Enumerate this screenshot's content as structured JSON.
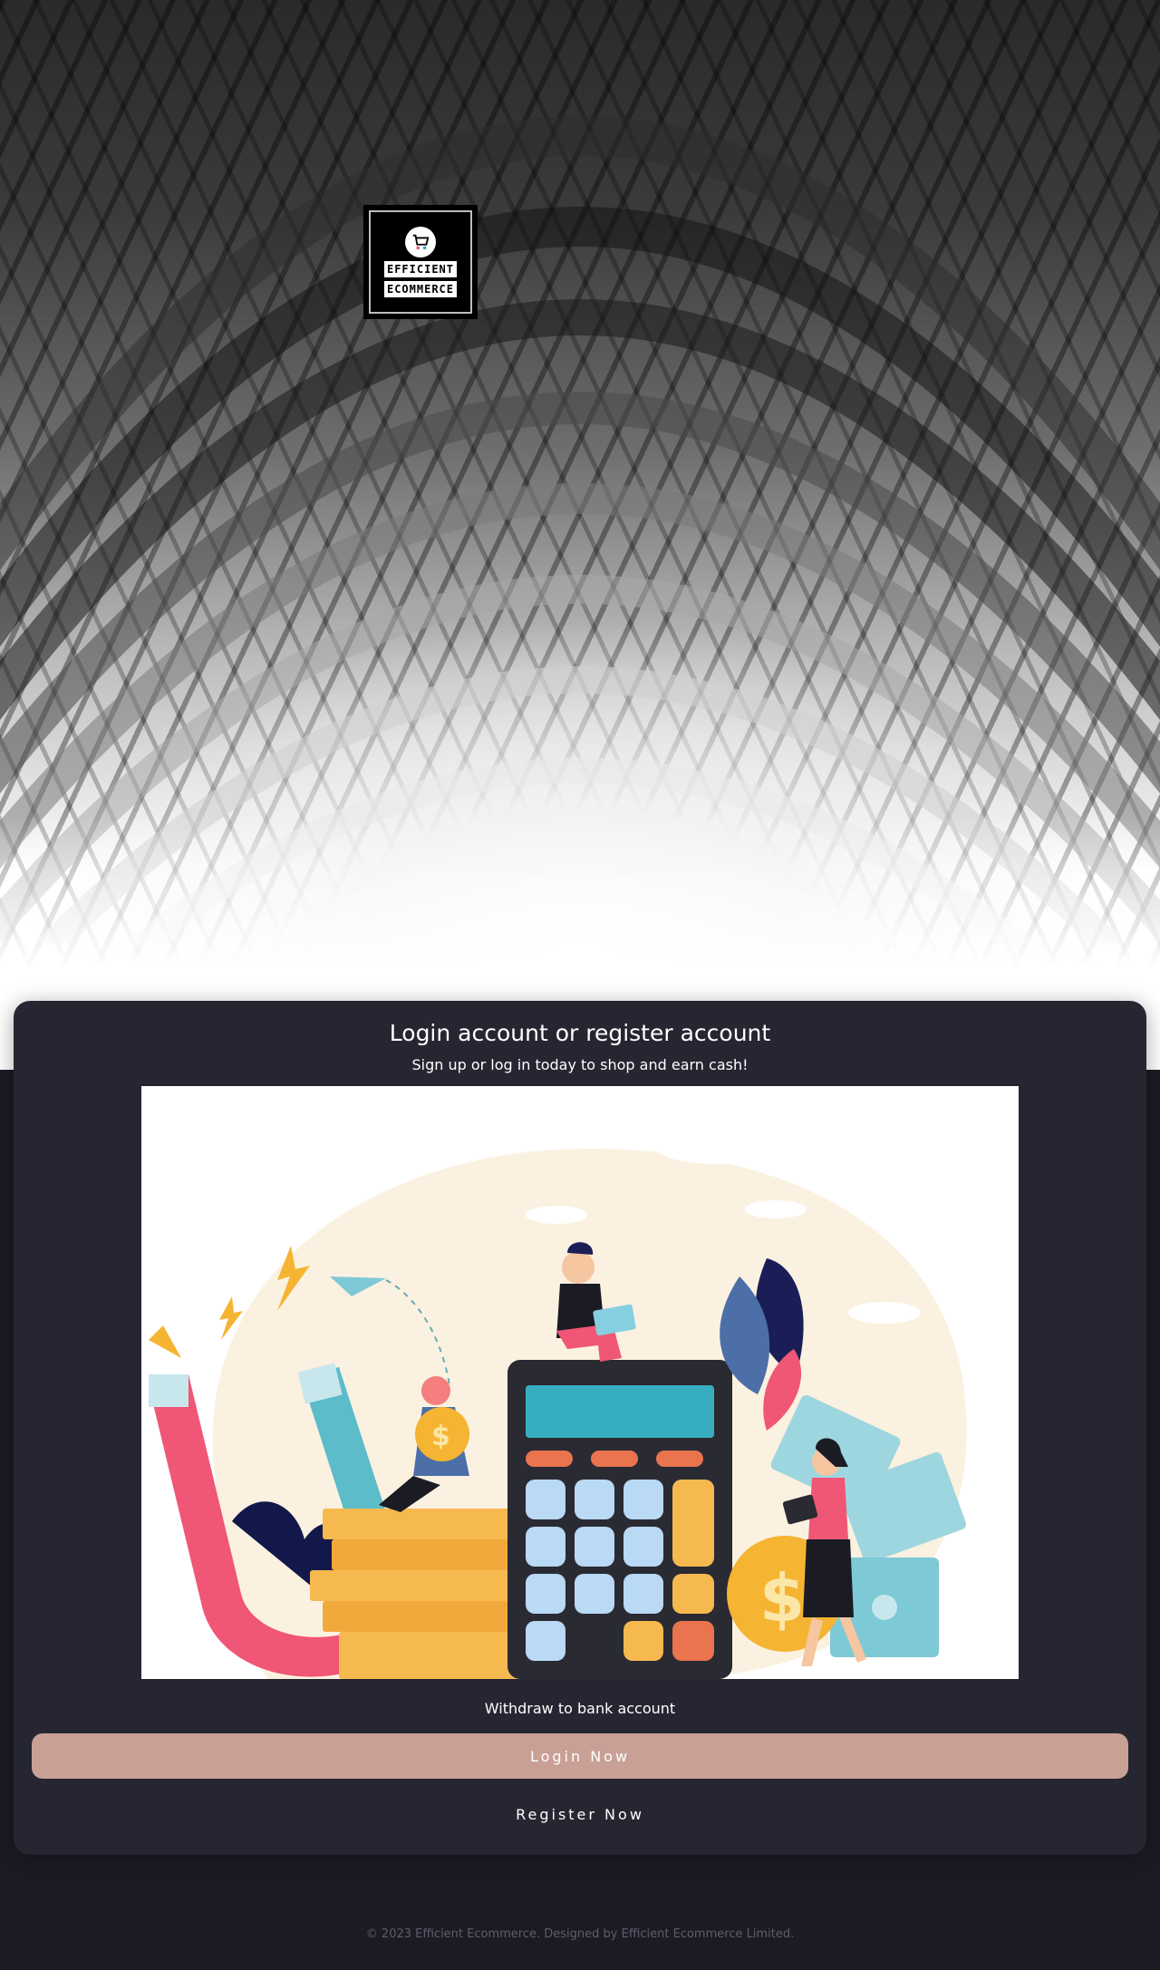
{
  "logo": {
    "line1": "EFFICIENT",
    "line2": "ECOMMERCE"
  },
  "card": {
    "title": "Login account or register account",
    "subtitle": "Sign up or log in today to shop and earn cash!",
    "illustration_caption": "Withdraw to bank account",
    "login_label": "Login   Now",
    "register_label": "Register   Now"
  },
  "footer": {
    "text": "© 2023 Efficient Ecommerce. Designed by Efficient Ecommerce Limited."
  },
  "colors": {
    "page_bg": "#1b1b24",
    "card_bg": "#262633",
    "login_button": "#c9a096",
    "footer_text": "#5e5e6e"
  },
  "icons": {
    "logo": "shopping-cart-icon"
  }
}
